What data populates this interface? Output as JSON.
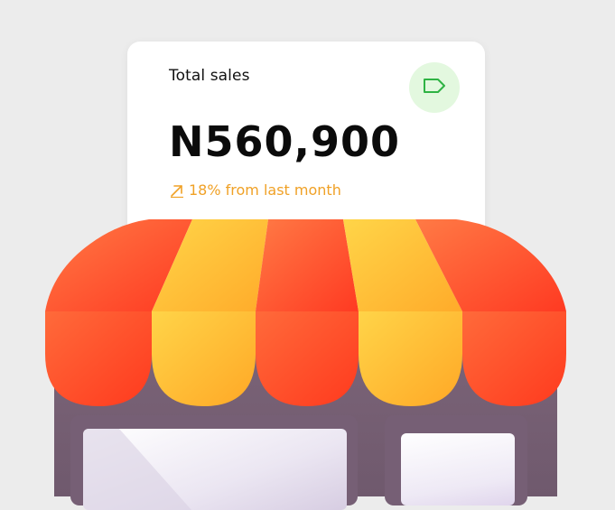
{
  "card": {
    "label": "Total sales",
    "value": "N560,900",
    "trend_text": "18% from last month",
    "trend_icon": "arrow-up-right-icon",
    "badge_icon": "tag-icon"
  },
  "colors": {
    "background": "#ececec",
    "card": "#ffffff",
    "trend": "#f0a126",
    "badge_bg": "#e3f8df",
    "badge_icon": "#2fb344",
    "awning_red": "#ff5a30",
    "awning_yellow": "#ffc93a",
    "store_body": "#765f75"
  }
}
